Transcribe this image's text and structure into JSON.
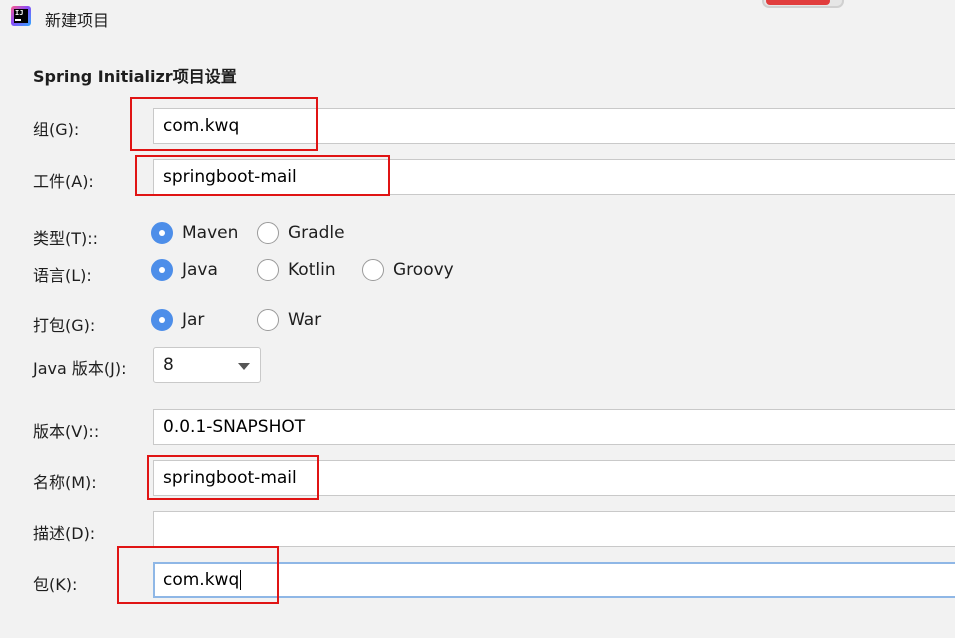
{
  "window": {
    "title": "新建项目"
  },
  "section": {
    "title": "Spring Initializr项目设置"
  },
  "form": {
    "group": {
      "label": "组(G):",
      "value": "com.kwq"
    },
    "artifact": {
      "label": "工件(A):",
      "value": "springboot-mail"
    },
    "type": {
      "label": "类型(T)::",
      "options": [
        "Maven",
        "Gradle"
      ],
      "selected": "Maven"
    },
    "language": {
      "label": "语言(L):",
      "options": [
        "Java",
        "Kotlin",
        "Groovy"
      ],
      "selected": "Java"
    },
    "packaging": {
      "label": "打包(G):",
      "options": [
        "Jar",
        "War"
      ],
      "selected": "Jar"
    },
    "java_version": {
      "label": "Java 版本(J):",
      "value": "8"
    },
    "version": {
      "label": "版本(V)::",
      "value": "0.0.1-SNAPSHOT"
    },
    "name": {
      "label": "名称(M):",
      "value": "springboot-mail"
    },
    "description": {
      "label": "描述(D):",
      "value": ""
    },
    "package": {
      "label": "包(K):",
      "value": "com.kwq"
    }
  },
  "colors": {
    "accent": "#4d8ee9",
    "highlight": "#e01414",
    "focus_border": "#8fb7e6"
  }
}
